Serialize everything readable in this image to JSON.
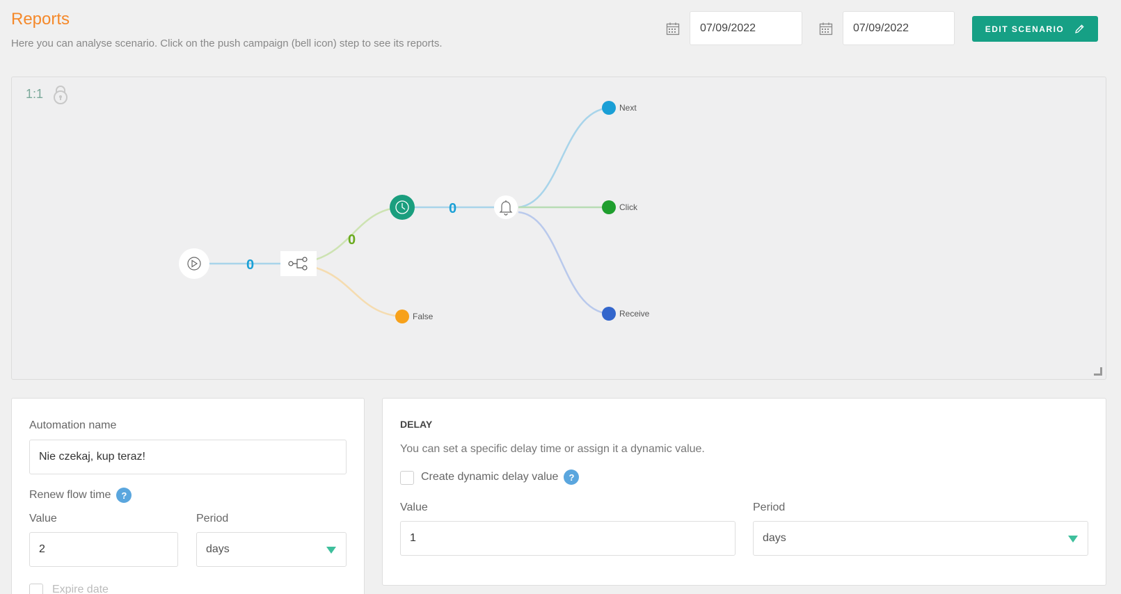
{
  "header": {
    "title": "Reports",
    "subtitle": "Here you can analyse scenario. Click on the push campaign (bell icon) step to see its reports.",
    "date_from": "07/09/2022",
    "date_to": "07/09/2022",
    "edit_label": "EDIT SCENARIO",
    "icons": [
      "calendar-icon",
      "calendar-icon",
      "pencil-icon"
    ],
    "accent_color": "#16a085",
    "title_color": "#f5892a"
  },
  "canvas": {
    "zoom_label": "1:1",
    "icons": [
      "lock-icon",
      "play-icon",
      "split-icon",
      "clock-icon",
      "bell-icon"
    ],
    "counts": {
      "start_to_split": "0",
      "split_to_delay": "0",
      "delay_to_push": "0"
    },
    "branch_labels": {
      "false": "False",
      "next": "Next",
      "click": "Click",
      "receive": "Receive"
    },
    "branch_colors": {
      "false": "#f7a11a",
      "next": "#1a9fd6",
      "click": "#1f9e2e",
      "receive": "#3366cc"
    }
  },
  "automation": {
    "name_label": "Automation name",
    "name_value": "Nie czekaj, kup teraz!",
    "renew_label": "Renew flow time",
    "value_label": "Value",
    "value": "2",
    "period_label": "Period",
    "period": "days",
    "expire_label": "Expire date"
  },
  "delay": {
    "title": "DELAY",
    "description": "You can set a specific delay time or assign it a dynamic value.",
    "dynamic_label": "Create dynamic delay value",
    "value_label": "Value",
    "value": "1",
    "period_label": "Period",
    "period": "days"
  }
}
